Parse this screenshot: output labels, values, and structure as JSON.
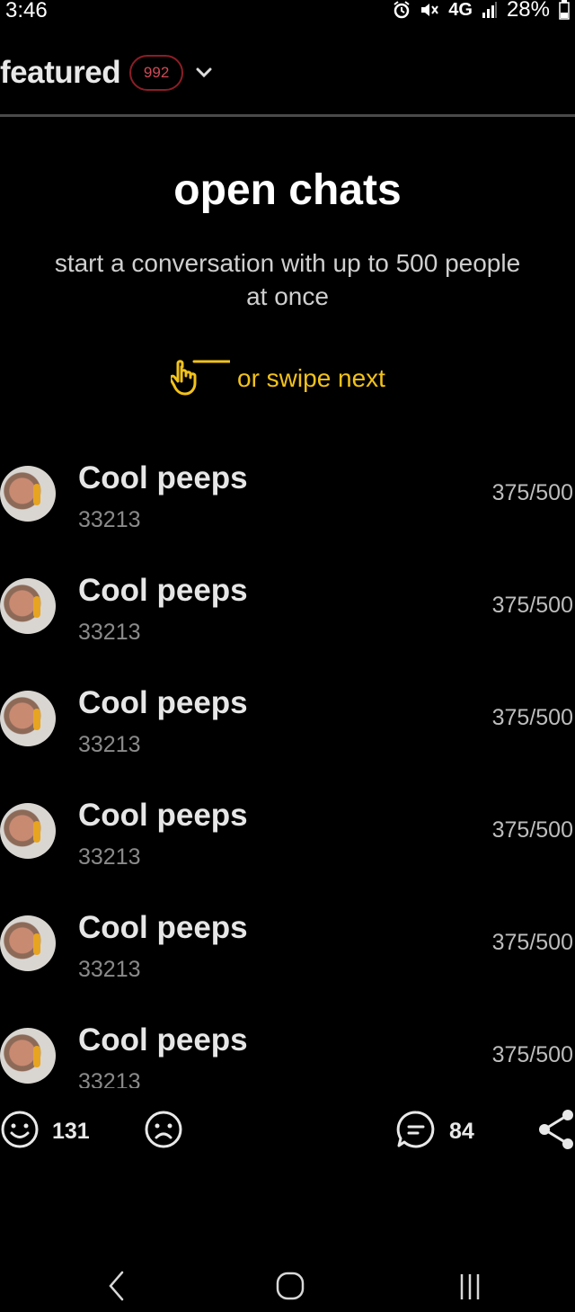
{
  "status_bar": {
    "time": "3:46",
    "network": "4G",
    "battery": "28%",
    "icons": [
      "alarm-icon",
      "mute-icon",
      "signal-icon",
      "battery-icon"
    ]
  },
  "header": {
    "title": "featured",
    "count": "992"
  },
  "hero": {
    "title": "open chats",
    "subtitle": "start a conversation with up to 500 people at once",
    "swipe_text": "or swipe next"
  },
  "chats": [
    {
      "name": "Cool peeps",
      "id": "33213",
      "members": "375/500"
    },
    {
      "name": "Cool peeps",
      "id": "33213",
      "members": "375/500"
    },
    {
      "name": "Cool peeps",
      "id": "33213",
      "members": "375/500"
    },
    {
      "name": "Cool peeps",
      "id": "33213",
      "members": "375/500"
    },
    {
      "name": "Cool peeps",
      "id": "33213",
      "members": "375/500"
    },
    {
      "name": "Cool peeps",
      "id": "33213",
      "members": "375/500"
    }
  ],
  "bottom_bar": {
    "like_count": "131",
    "comment_count": "84"
  },
  "colors": {
    "accent_yellow": "#f2c21a",
    "badge_red": "#8c1d26",
    "background": "#000000"
  }
}
